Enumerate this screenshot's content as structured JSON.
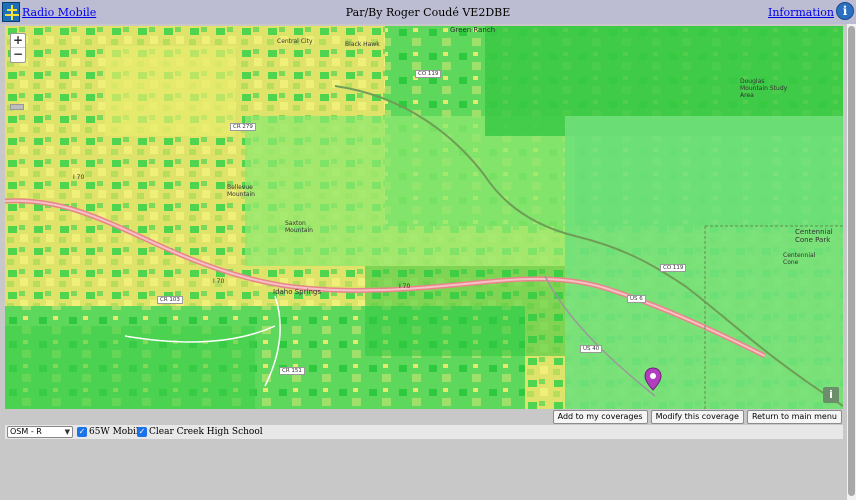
{
  "header": {
    "app_link": "Radio Mobile",
    "title": "Par/By Roger Coudé VE2DBE",
    "info_link": "Information",
    "info_icon_glyph": "i"
  },
  "map": {
    "zoom_in": "+",
    "zoom_out": "−",
    "info_glyph": "i",
    "marker_icon": "map-pin-icon",
    "labels": {
      "green_ranch": "Green Ranch",
      "central_city": "Central City",
      "black_hawk": "Black Hawk",
      "co119_top": "CO 119",
      "co119_right": "CO 119",
      "bellevue_mtn": "Douglas Mountain Study Area",
      "centennial": "Centennial Cone Park",
      "centennial_cone": "Centennial Cone",
      "cr279": "CR 279",
      "i70_left": "I 70",
      "i70_mid": "I 70",
      "i70_right": "I 70",
      "idaho_springs": "Idaho Springs",
      "cr103": "CR 103",
      "cr151": "CR 151",
      "us6": "US 6",
      "us40": "US 40",
      "saxton": "Saxton Mountain",
      "bellevue": "Bellevue Mountain"
    }
  },
  "buttons": {
    "add": "Add to my coverages",
    "modify": "Modify this coverage",
    "return": "Return to main menu"
  },
  "controls": {
    "layer_select": "OSM - R",
    "checkbox1_label": "65W Mobile",
    "checkbox2_label": "Clear Creek High School",
    "check_glyph": "✓"
  }
}
